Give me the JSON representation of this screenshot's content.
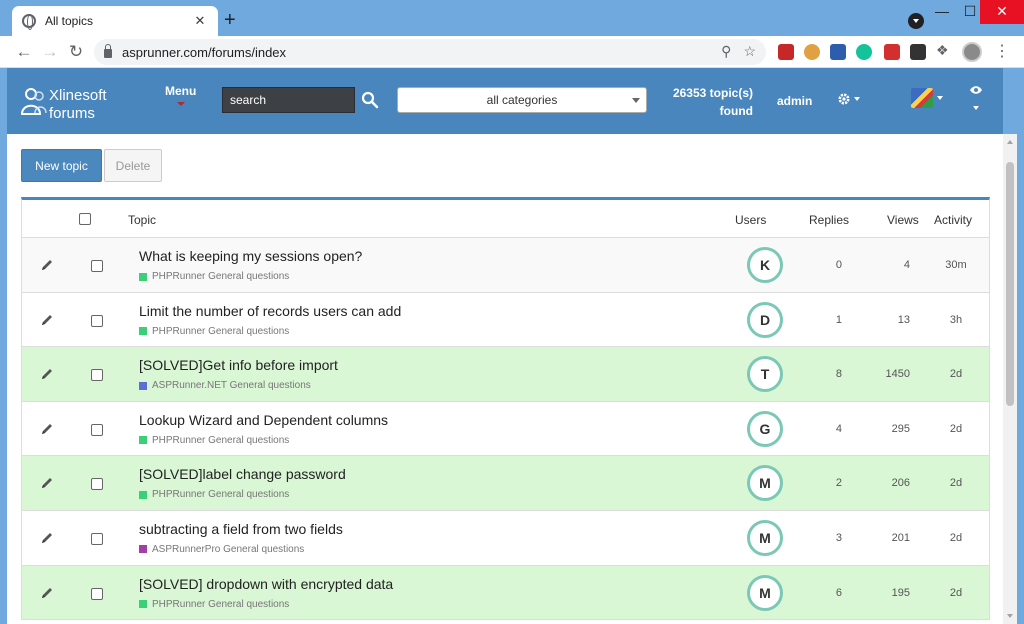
{
  "browser": {
    "tab_title": "All topics",
    "tab_close": "✕",
    "new_tab": "+",
    "url": "asprunner.com/forums/index",
    "win_min": "—",
    "win_max": "☐",
    "win_close": "✕"
  },
  "header": {
    "brand_line1": "Xlinesoft",
    "brand_line2": "forums",
    "menu_label": "Menu",
    "search_placeholder": "search",
    "category_value": "all categories",
    "found_line1": "26353 topic(s)",
    "found_line2": "found",
    "user": "admin"
  },
  "actions": {
    "new_topic": "New topic",
    "delete": "Delete"
  },
  "columns": {
    "topic": "Topic",
    "users": "Users",
    "replies": "Replies",
    "views": "Views",
    "activity": "Activity"
  },
  "colors": {
    "brand": "#4986bd",
    "solved_row": "#d9f6d5",
    "phprunner": "#3ccf7a",
    "aspnet": "#5b6fd6",
    "asprunnerpro": "#a13fa5"
  },
  "topics": [
    {
      "title": "What is keeping my sessions open?",
      "category": "PHPRunner General questions",
      "cat_color": "#3ccf7a",
      "user": "K",
      "replies": "0",
      "views": "4",
      "activity": "30m",
      "solved": false
    },
    {
      "title": "Limit the number of records users can add",
      "category": "PHPRunner General questions",
      "cat_color": "#3ccf7a",
      "user": "D",
      "replies": "1",
      "views": "13",
      "activity": "3h",
      "solved": false
    },
    {
      "title": "[SOLVED]Get info before import",
      "category": "ASPRunner.NET General questions",
      "cat_color": "#5b6fd6",
      "user": "T",
      "replies": "8",
      "views": "1450",
      "activity": "2d",
      "solved": true
    },
    {
      "title": "Lookup Wizard and Dependent columns",
      "category": "PHPRunner General questions",
      "cat_color": "#3ccf7a",
      "user": "G",
      "replies": "4",
      "views": "295",
      "activity": "2d",
      "solved": false
    },
    {
      "title": "[SOLVED]label change password",
      "category": "PHPRunner General questions",
      "cat_color": "#3ccf7a",
      "user": "M",
      "replies": "2",
      "views": "206",
      "activity": "2d",
      "solved": true
    },
    {
      "title": "subtracting a field from two fields",
      "category": "ASPRunnerPro General questions",
      "cat_color": "#a13fa5",
      "user": "M",
      "replies": "3",
      "views": "201",
      "activity": "2d",
      "solved": false
    },
    {
      "title": "[SOLVED] dropdown with encrypted data",
      "category": "PHPRunner General questions",
      "cat_color": "#3ccf7a",
      "user": "M",
      "replies": "6",
      "views": "195",
      "activity": "2d",
      "solved": true
    }
  ]
}
